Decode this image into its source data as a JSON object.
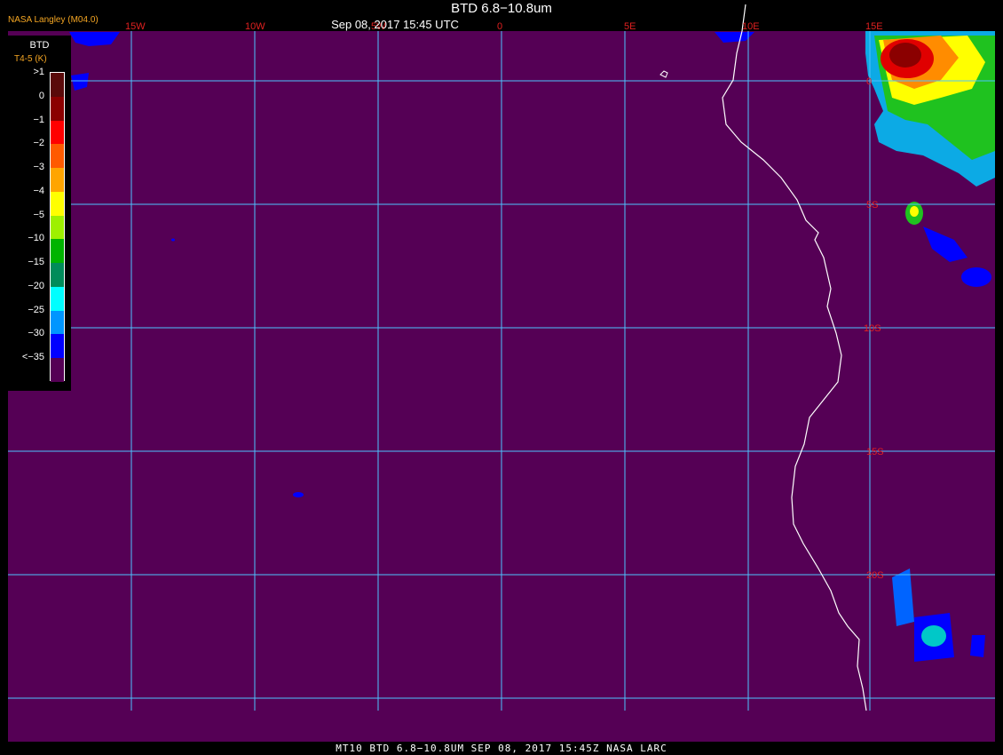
{
  "header": {
    "title": "BTD 6.8−10.8um",
    "timestamp": "Sep 08, 2017 15:45 UTC",
    "agency": "NASA Langley (M04.0)"
  },
  "legend": {
    "title": "BTD",
    "unit": "T4-5 (K)",
    "labels": [
      ">1",
      "0",
      "−1",
      "−2",
      "−3",
      "−4",
      "−5",
      "−10",
      "−15",
      "−20",
      "−25",
      "−30",
      "<−35"
    ],
    "colors": [
      "#5a0a0a",
      "#8b0000",
      "#ff0000",
      "#ff5a00",
      "#ffa500",
      "#ffff00",
      "#9ef000",
      "#00b400",
      "#008c5a",
      "#00ffff",
      "#0096ff",
      "#0000ff",
      "#550055"
    ]
  },
  "map": {
    "background_color": "#550055",
    "grid_color": "#4dc3ff",
    "coast_color": "#ffffff",
    "longitude_labels": [
      "15W",
      "10W",
      "5W",
      "0",
      "5E",
      "10E",
      "15E"
    ],
    "latitude_labels": [
      "0",
      "5S",
      "10S",
      "15S",
      "20S"
    ],
    "label_color": "#e02020"
  },
  "footer": {
    "text": "MT10  BTD 6.8−10.8UM   SEP 08, 2017 15:45Z   NASA LARC"
  }
}
